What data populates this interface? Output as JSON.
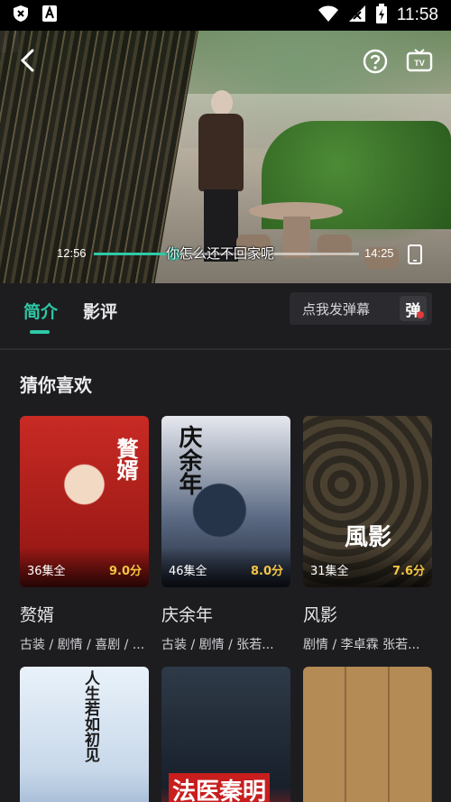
{
  "status_bar": {
    "time": "11:58",
    "icons": [
      "shield-icon",
      "a-icon",
      "wifi-icon",
      "signal-icon",
      "battery-charging-icon"
    ]
  },
  "player": {
    "current_time": "12:56",
    "duration": "14:25",
    "progress_fraction": 0.3,
    "danmaku_text": "你怎么还不回家呢",
    "icons": [
      "back-icon",
      "help-icon",
      "tv-icon",
      "pause-icon",
      "rotate-icon"
    ]
  },
  "tabs": {
    "intro": "简介",
    "reviews": "影评"
  },
  "danmu": {
    "placeholder": "点我发弹幕",
    "button": "弹"
  },
  "recommend": {
    "title": "猜你喜欢",
    "items": [
      {
        "title": "赘婿",
        "episodes": "36集全",
        "score": "9.0分",
        "tags": "古装 / 剧情 / 喜剧 / ...",
        "poster_text": "贅婿"
      },
      {
        "title": "庆余年",
        "episodes": "46集全",
        "score": "8.0分",
        "tags": "古装 / 剧情 / 张若...",
        "poster_text": "庆余年"
      },
      {
        "title": "风影",
        "episodes": "31集全",
        "score": "7.6分",
        "tags": "剧情 / 李卓霖 张若...",
        "poster_text": "風影"
      },
      {
        "title": "",
        "episodes": "",
        "score": "",
        "tags": "",
        "poster_text": "人生若如初见"
      },
      {
        "title": "",
        "episodes": "",
        "score": "",
        "tags": "",
        "poster_text": "法医秦明"
      },
      {
        "title": "",
        "episodes": "",
        "score": "",
        "tags": "",
        "poster_text": ""
      }
    ]
  },
  "colors": {
    "accent": "#2fc9a6",
    "score": "#f6c445",
    "background": "#1d1d20"
  }
}
